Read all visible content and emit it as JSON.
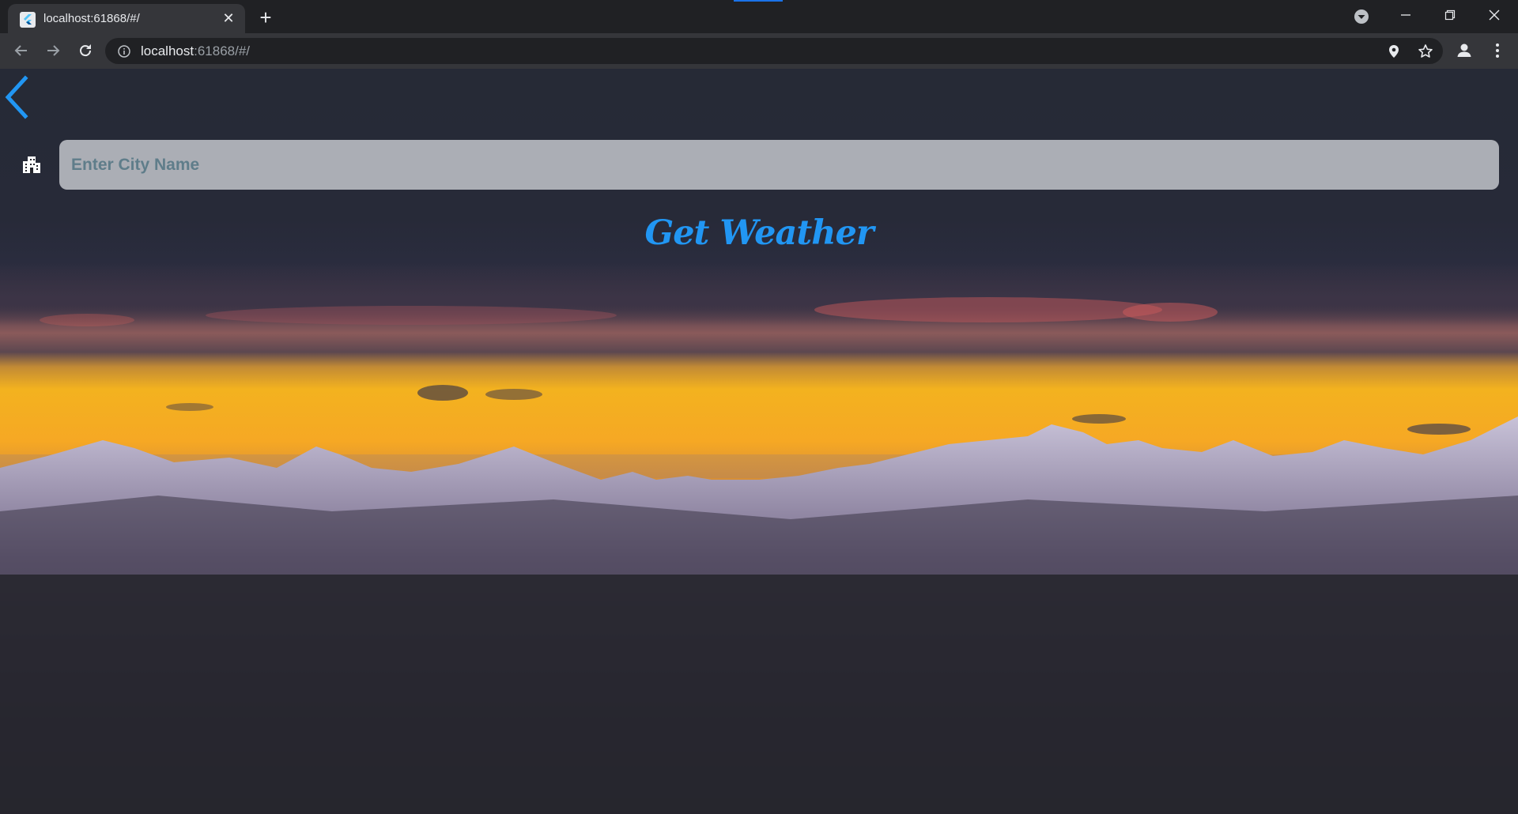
{
  "browser": {
    "tab": {
      "title": "localhost:61868/#/",
      "close_glyph": "✕",
      "favicon": "flutter-icon"
    },
    "new_tab_glyph": "+",
    "address_bar": {
      "host": "localhost",
      "path": ":61868/#/"
    },
    "colors": {
      "frame": "#202124",
      "toolbar": "#35363a",
      "accent": "#1a73e8"
    }
  },
  "app": {
    "search": {
      "placeholder": "Enter City Name",
      "value": ""
    },
    "get_weather_label": "Get Weather",
    "colors": {
      "accent": "#2196f3",
      "background": "#24252c"
    }
  }
}
